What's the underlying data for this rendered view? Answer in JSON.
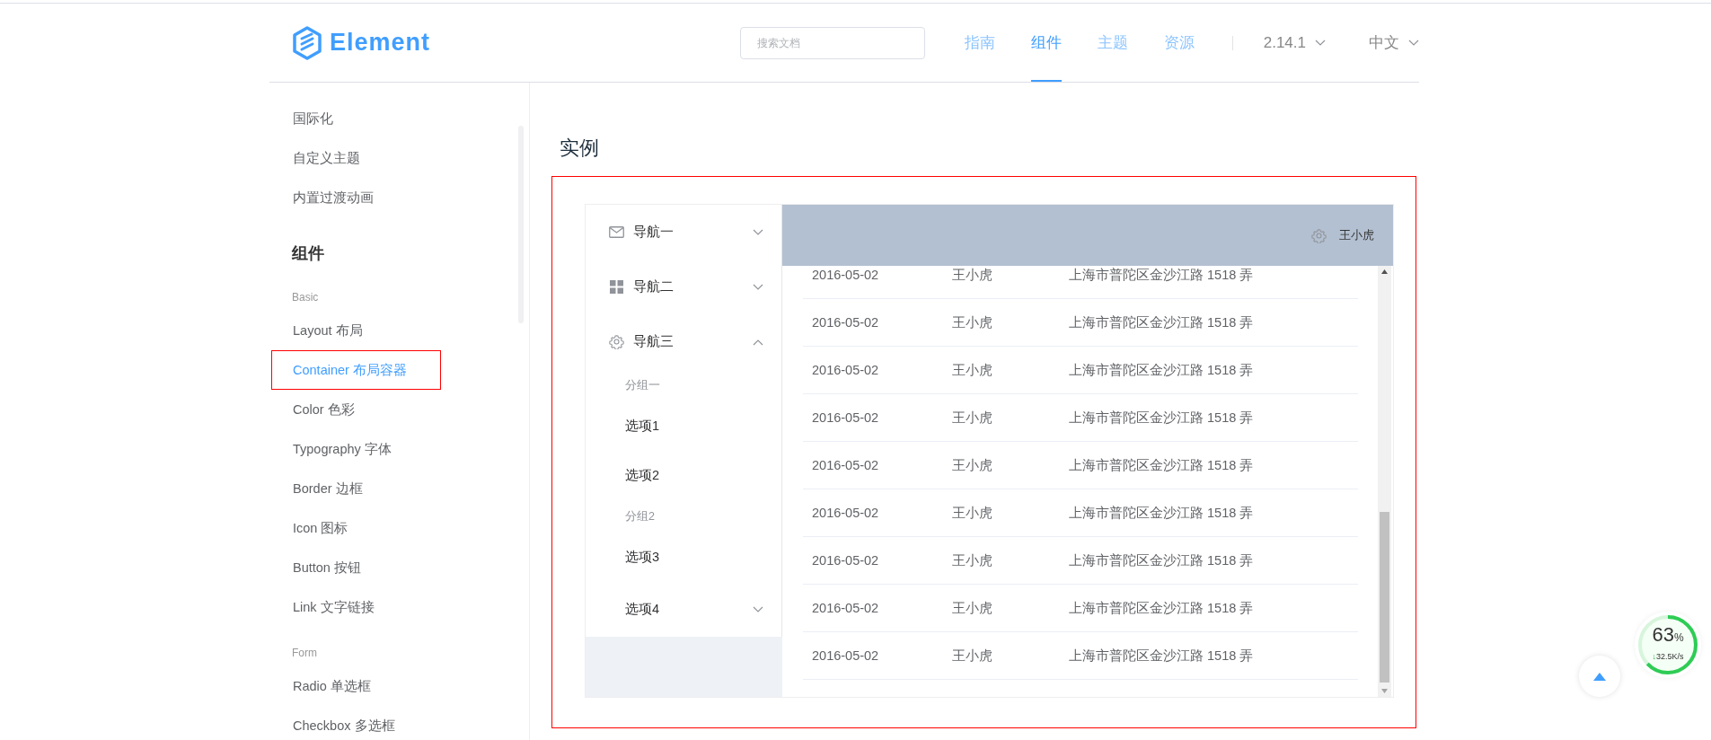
{
  "header": {
    "logo_text": "Element",
    "search": {
      "placeholder": "搜索文档"
    },
    "nav": [
      {
        "label": "指南",
        "selected": false
      },
      {
        "label": "组件",
        "selected": true
      },
      {
        "label": "主题",
        "selected": false
      },
      {
        "label": "资源",
        "selected": false
      }
    ],
    "version": "2.14.1",
    "language": "中文"
  },
  "sidebar": {
    "items": [
      {
        "kind": "link",
        "label": "国际化",
        "selected": false,
        "outlined": false
      },
      {
        "kind": "link",
        "label": "自定义主题",
        "selected": false,
        "outlined": false
      },
      {
        "kind": "link",
        "label": "内置过渡动画",
        "selected": false,
        "outlined": false
      },
      {
        "kind": "heading",
        "label": "组件"
      },
      {
        "kind": "category",
        "label": "Basic"
      },
      {
        "kind": "link",
        "label": "Layout 布局",
        "selected": false,
        "outlined": false
      },
      {
        "kind": "link",
        "label": "Container 布局容器",
        "selected": true,
        "outlined": true
      },
      {
        "kind": "link",
        "label": "Color 色彩",
        "selected": false,
        "outlined": false
      },
      {
        "kind": "link",
        "label": "Typography 字体",
        "selected": false,
        "outlined": false
      },
      {
        "kind": "link",
        "label": "Border 边框",
        "selected": false,
        "outlined": false
      },
      {
        "kind": "link",
        "label": "Icon 图标",
        "selected": false,
        "outlined": false
      },
      {
        "kind": "link",
        "label": "Button 按钮",
        "selected": false,
        "outlined": false
      },
      {
        "kind": "link",
        "label": "Link 文字链接",
        "selected": false,
        "outlined": false
      },
      {
        "kind": "category",
        "label": "Form"
      },
      {
        "kind": "link",
        "label": "Radio 单选框",
        "selected": false,
        "outlined": false
      },
      {
        "kind": "link",
        "label": "Checkbox 多选框",
        "selected": false,
        "outlined": false
      }
    ]
  },
  "main": {
    "title": "实例",
    "outlined": true,
    "demo": {
      "menu": [
        {
          "kind": "submenu",
          "label": "导航一",
          "expanded": false
        },
        {
          "kind": "submenu",
          "label": "导航二",
          "expanded": false
        },
        {
          "kind": "submenu",
          "label": "导航三",
          "expanded": true,
          "children": [
            {
              "kind": "group",
              "label": "分组一",
              "children": [
                {
                  "kind": "item",
                  "label": "选项1"
                },
                {
                  "kind": "item",
                  "label": "选项2"
                }
              ]
            },
            {
              "kind": "group",
              "label": "分组2",
              "children": [
                {
                  "kind": "item",
                  "label": "选项3"
                }
              ]
            },
            {
              "kind": "submenu",
              "label": "选项4",
              "expanded": false
            }
          ]
        }
      ],
      "header_user": "王小虎",
      "table": {
        "rows": [
          [
            "2016-05-02",
            "王小虎",
            "上海市普陀区金沙江路 1518 弄"
          ],
          [
            "2016-05-02",
            "王小虎",
            "上海市普陀区金沙江路 1518 弄"
          ],
          [
            "2016-05-02",
            "王小虎",
            "上海市普陀区金沙江路 1518 弄"
          ],
          [
            "2016-05-02",
            "王小虎",
            "上海市普陀区金沙江路 1518 弄"
          ],
          [
            "2016-05-02",
            "王小虎",
            "上海市普陀区金沙江路 1518 弄"
          ],
          [
            "2016-05-02",
            "王小虎",
            "上海市普陀区金沙江路 1518 弄"
          ],
          [
            "2016-05-02",
            "王小虎",
            "上海市普陀区金沙江路 1518 弄"
          ],
          [
            "2016-05-02",
            "王小虎",
            "上海市普陀区金沙江路 1518 弄"
          ],
          [
            "2016-05-02",
            "王小虎",
            "上海市普陀区金沙江路 1518 弄"
          ]
        ]
      }
    }
  },
  "network_meter": {
    "level": 0.63,
    "percent": "63",
    "unit": "%",
    "arrow": "↓",
    "speed": "32.5K/s"
  }
}
